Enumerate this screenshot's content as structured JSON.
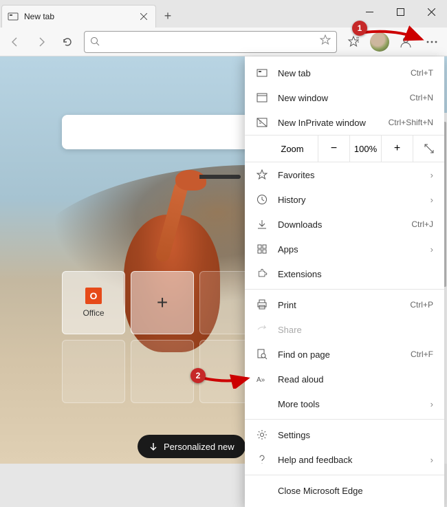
{
  "window": {
    "tab_title": "New tab"
  },
  "toolbar": {
    "search_placeholder": ""
  },
  "tiles": [
    {
      "label": "Office",
      "icon": "office"
    },
    {
      "label": "",
      "icon": "plus"
    }
  ],
  "bottom_chip": "Personalized new",
  "menu": {
    "items": [
      {
        "icon": "new-tab",
        "label": "New tab",
        "shortcut": "Ctrl+T"
      },
      {
        "icon": "window",
        "label": "New window",
        "shortcut": "Ctrl+N"
      },
      {
        "icon": "inprivate",
        "label": "New InPrivate window",
        "shortcut": "Ctrl+Shift+N"
      }
    ],
    "zoom": {
      "label": "Zoom",
      "value": "100%"
    },
    "items2": [
      {
        "icon": "star-plus",
        "label": "Favorites",
        "chevron": true
      },
      {
        "icon": "history",
        "label": "History",
        "chevron": true
      },
      {
        "icon": "download",
        "label": "Downloads",
        "shortcut": "Ctrl+J"
      },
      {
        "icon": "apps",
        "label": "Apps",
        "chevron": true
      },
      {
        "icon": "puzzle",
        "label": "Extensions"
      }
    ],
    "items3": [
      {
        "icon": "print",
        "label": "Print",
        "shortcut": "Ctrl+P"
      },
      {
        "icon": "share",
        "label": "Share",
        "disabled": true
      },
      {
        "icon": "find",
        "label": "Find on page",
        "shortcut": "Ctrl+F"
      },
      {
        "icon": "readaloud",
        "label": "Read aloud"
      },
      {
        "icon": "",
        "label": "More tools",
        "chevron": true
      }
    ],
    "items4": [
      {
        "icon": "gear",
        "label": "Settings"
      },
      {
        "icon": "help",
        "label": "Help and feedback",
        "chevron": true
      }
    ],
    "close_label": "Close Microsoft Edge"
  },
  "annotations": {
    "step1": "1",
    "step2": "2"
  }
}
